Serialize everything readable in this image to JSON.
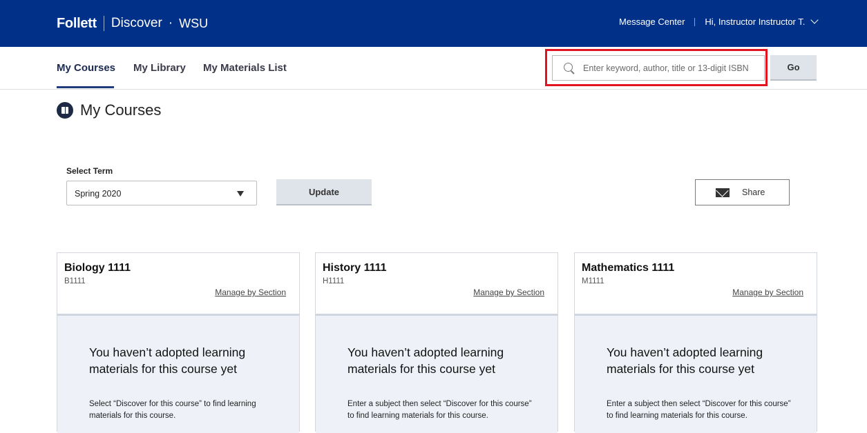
{
  "header": {
    "brand": "Follett",
    "product": "Discover",
    "separator_dot": "·",
    "school": "WSU",
    "message_center": "Message Center",
    "user_greeting": "Hi, Instructor Instructor T."
  },
  "nav": {
    "tabs": [
      {
        "label": "My Courses"
      },
      {
        "label": "My Library"
      },
      {
        "label": "My Materials List"
      }
    ],
    "search": {
      "placeholder": "Enter keyword, author, title or 13-digit ISBN",
      "value": ""
    },
    "go_label": "Go"
  },
  "page": {
    "title": "My Courses"
  },
  "term": {
    "label": "Select Term",
    "selected": "Spring 2020",
    "update_label": "Update",
    "share_label": "Share"
  },
  "courses": [
    {
      "title": "Biology 1111",
      "code": "B1111",
      "manage_label": "Manage by Section",
      "empty_title": "You haven’t adopted learning materials for this course yet",
      "empty_desc": "Select “Discover for this course” to find learning materials for this course."
    },
    {
      "title": "History 1111",
      "code": "H1111",
      "manage_label": "Manage by Section",
      "empty_title": "You haven’t adopted learning materials for this course yet",
      "empty_desc": "Enter a subject then select “Discover for this course” to find learning materials for this course."
    },
    {
      "title": "Mathematics 1111",
      "code": "M1111",
      "manage_label": "Manage by Section",
      "empty_title": "You haven’t adopted learning materials for this course yet",
      "empty_desc": "Enter a subject then select “Discover for this course” to find learning materials for this course."
    }
  ],
  "colors": {
    "header_bg": "#003087",
    "highlight": "#e3121f",
    "card_body_bg": "#eef2f8"
  }
}
